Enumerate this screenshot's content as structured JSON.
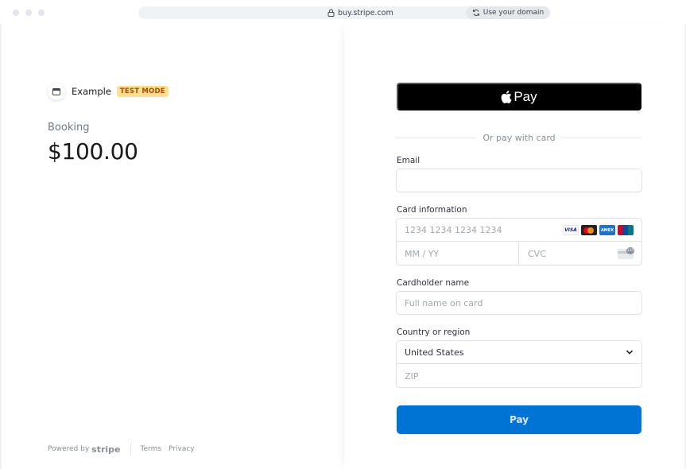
{
  "browser": {
    "url": "buy.stripe.com",
    "domain_button": "Use your domain"
  },
  "merchant": {
    "name": "Example",
    "badge": "TEST MODE"
  },
  "product": {
    "name": "Booking",
    "price": "$100.00"
  },
  "footer": {
    "powered_by": "Powered by",
    "brand": "stripe",
    "terms": "Terms",
    "privacy": "Privacy"
  },
  "payment": {
    "apple_pay_label": "Pay",
    "divider_text": "Or pay with card",
    "email_label": "Email",
    "email_value": "",
    "card_label": "Card information",
    "card_number_placeholder": "1234 1234 1234 1234",
    "expiry_placeholder": "MM / YY",
    "cvc_placeholder": "CVC",
    "card_brands": [
      "VISA",
      "mastercard",
      "AMEX",
      "UnionPay"
    ],
    "cardholder_label": "Cardholder name",
    "cardholder_placeholder": "Full name on card",
    "country_label": "Country or region",
    "country_value": "United States",
    "zip_placeholder": "ZIP",
    "pay_button": "Pay"
  },
  "colors": {
    "pay_button": "#0074d4",
    "test_badge_bg": "#ffde92",
    "test_badge_text": "#a94a00"
  }
}
